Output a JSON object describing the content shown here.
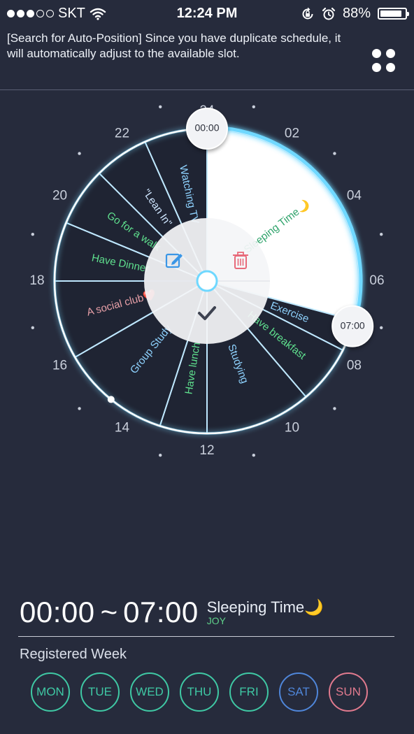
{
  "status_bar": {
    "carrier": "SKT",
    "time": "12:24 PM",
    "battery_percent": "88%",
    "battery_level": 0.88,
    "signal_bars": 3,
    "signal_total": 5
  },
  "notice": {
    "text": "[Search for Auto-Position] Since you have duplicate schedule, it will automatically adjust to the available slot."
  },
  "clock": {
    "hour_labels": [
      "24",
      "02",
      "04",
      "06",
      "08",
      "10",
      "12",
      "14",
      "16",
      "18",
      "20",
      "22"
    ],
    "start_handle": "00:00",
    "end_handle": "07:00",
    "schedules": [
      {
        "label": "Sleeping Time🌙",
        "start": 0,
        "end": 7,
        "selected": true,
        "color": "#2fa36b"
      },
      {
        "label": "Exercise",
        "start": 7,
        "end": 7.8,
        "color": "#8fd3ff"
      },
      {
        "label": "Have breakfast",
        "start": 7.8,
        "end": 9.3,
        "color": "#5fe08e"
      },
      {
        "label": "Studying",
        "start": 9.3,
        "end": 12,
        "color": "#8fd3ff"
      },
      {
        "label": "Have lunch",
        "start": 12,
        "end": 13.2,
        "color": "#5fe08e"
      },
      {
        "label": "Group Study",
        "start": 13.2,
        "end": 16,
        "color": "#8fd3ff"
      },
      {
        "label": "A social club❤️",
        "start": 16,
        "end": 18,
        "color": "#e8a0a8"
      },
      {
        "label": "Have Dinner",
        "start": 18,
        "end": 19.5,
        "color": "#5fe08e"
      },
      {
        "label": "Go for a walk",
        "start": 19.5,
        "end": 21,
        "color": "#5fe08e"
      },
      {
        "label": "\"Lean In\"",
        "start": 21,
        "end": 22.4,
        "color": "#cfe6ff"
      },
      {
        "label": "Watching TV",
        "start": 22.4,
        "end": 24,
        "color": "#8fd3ff"
      }
    ],
    "actions": {
      "edit_icon": "pencil-square-icon",
      "delete_icon": "trash-icon",
      "confirm_icon": "checkmark-icon"
    }
  },
  "selected": {
    "start": "00:00",
    "end": "07:00",
    "tilde": "~",
    "title": "Sleeping Time",
    "title_emoji": "🌙",
    "subtitle": "JOY"
  },
  "week": {
    "label": "Registered Week",
    "days": [
      "MON",
      "TUE",
      "WED",
      "THU",
      "FRI",
      "SAT",
      "SUN"
    ]
  },
  "colors": {
    "background": "#262b3c",
    "accent_glow": "#6fd8ff",
    "weekday": "#3fc8a4",
    "saturday": "#4f86d9",
    "sunday": "#e07a8e"
  }
}
